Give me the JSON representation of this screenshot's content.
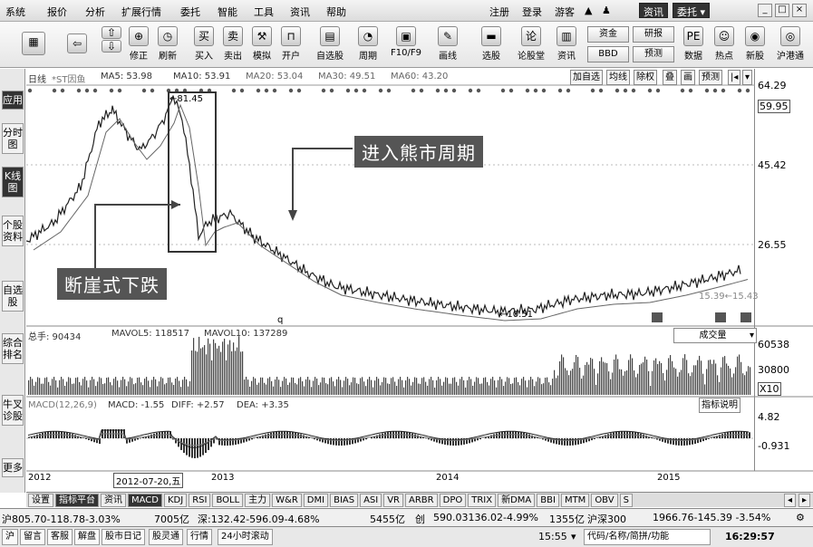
{
  "menu": {
    "items": [
      "系统",
      "报价",
      "分析",
      "扩展行情",
      "委托",
      "智能",
      "工具",
      "资讯",
      "帮助"
    ],
    "right": [
      "注册",
      "登录",
      "游客"
    ],
    "info_btn": "资讯",
    "trade_btn": "委托"
  },
  "toolbar": {
    "buttons": [
      "修正",
      "刷新",
      "买入",
      "卖出",
      "模拟",
      "开户",
      "自选股",
      "周期",
      "F10/F9",
      "画线",
      "选股",
      "论股堂",
      "资讯"
    ],
    "box_top": [
      "资金",
      "研报"
    ],
    "box_bottom": [
      "BBD",
      "预测"
    ],
    "right_buttons": [
      "数据",
      "热点",
      "新股",
      "沪港通"
    ]
  },
  "left_tabs": [
    "应用",
    "分时图",
    "K线图",
    "个股资料",
    "自选股",
    "综合排名",
    "牛叉诊股",
    "更多"
  ],
  "chart": {
    "info_line": [
      "日线",
      "*ST因鱼",
      "MA5: 53.98",
      "MA10: 53.91",
      "MA20: 53.04",
      "MA30: 49.51",
      "MA60: 43.20"
    ],
    "right_buttons": [
      "加自选",
      "均线",
      "除权",
      "叠",
      "画",
      "预测"
    ],
    "price_labels": [
      "64.29",
      "59.95",
      "45.42",
      "26.55"
    ],
    "peak_label": "81.45",
    "low_label": "10.51",
    "last_label": "15.39←15.43",
    "annotation_bear": "进入熊市周期",
    "annotation_cliff": "断崖式下跌",
    "vol_info": [
      "总手: 90434",
      "MAVOL5: 118517",
      "MAVOL10: 137289"
    ],
    "vol_select": "成交量",
    "vol_labels": [
      "60538",
      "30800",
      "X10"
    ],
    "macd_info": [
      "MACD(12,26,9)",
      "MACD: -1.55",
      "DIFF: +2.57",
      "DEA: +3.35"
    ],
    "macd_btn": "指标说明",
    "macd_labels": [
      "4.82",
      "-0.931"
    ],
    "x_labels": [
      "2012",
      "2012-07-20,五",
      "2013",
      "2014",
      "2015"
    ]
  },
  "chart_data": {
    "type": "line",
    "x": [
      "2012",
      "2013",
      "2014",
      "2015"
    ],
    "series": [],
    "ylim": [
      10.51,
      81.45
    ],
    "y_ticks": [
      26.55,
      45.42,
      59.95,
      64.29
    ],
    "peak": 81.45,
    "low": 10.51
  },
  "bottom_tabs": [
    "设置",
    "指标平台",
    "资讯",
    "MACD",
    "KDJ",
    "RSI",
    "BOLL",
    "主力",
    "W&R",
    "DMI",
    "BIAS",
    "ASI",
    "VR",
    "ARBR",
    "DPO",
    "TRIX",
    "新DMA",
    "BBI",
    "MTM",
    "OBV",
    "S"
  ],
  "status": {
    "sh": "沪805.70-118.78-3.03%",
    "sh_amt": "7005亿",
    "sz": "深:132.42-596.09-4.68%",
    "sz_amt": "5455亿",
    "cy": "创",
    "cy_val": "590.03136.02-4.99%",
    "cy_amt": "1355亿",
    "hs300_label": "沪深300",
    "hs300": "1966.76-145.39 -3.54%",
    "bottom_items": [
      "沪",
      "留言",
      "客服",
      "解盘",
      "股市日记",
      "股灵通",
      "行情",
      "24小时滚动"
    ],
    "time1": "15:55",
    "search": "代码/名称/简拼/功能",
    "time2": "16:29:57"
  },
  "colors": {
    "annotation_bg": "#555555",
    "dark_tab": "#333333"
  }
}
